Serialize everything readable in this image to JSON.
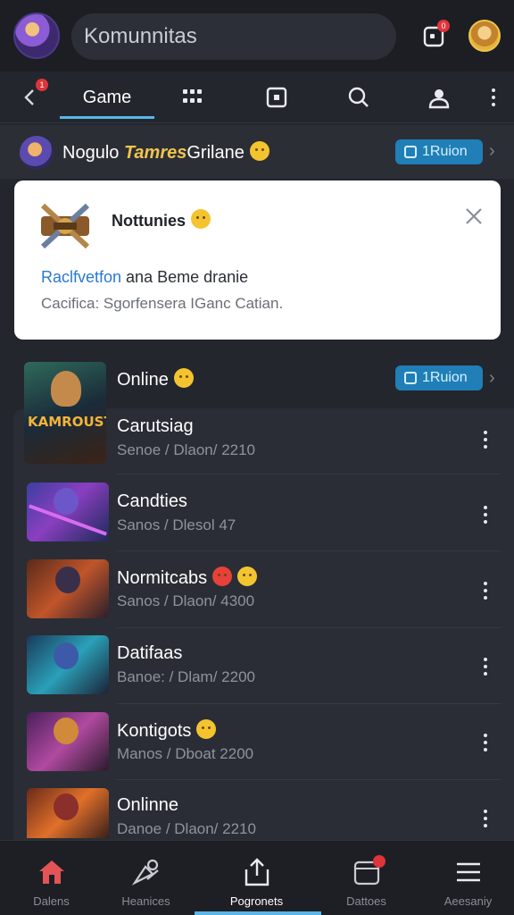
{
  "header": {
    "search_text": "Komunnitas",
    "notification_count": "0"
  },
  "tabs": {
    "active_label": "Game",
    "back_badge": "1",
    "icons": [
      "back-icon",
      "grid-icon",
      "square-icon",
      "search-icon",
      "user-icon",
      "more-icon"
    ]
  },
  "banner": {
    "title_prefix": "Nogulo ",
    "title_highlight": "Tamres",
    "title_suffix": "Grilane",
    "pill_label": "1Ruion"
  },
  "notification": {
    "title": "Nottunies",
    "line1_blue": "Raclfvetfon",
    "line1_rest": " ana  Beme dranie",
    "line2": "Cacifica: Sgorfensera IGanc Catian."
  },
  "online_header": {
    "label": "Online",
    "pill_label": "1Ruion"
  },
  "list": [
    {
      "title": "Carutsiag",
      "subtitle": "Senoe / Dlaon/ 2210",
      "thumb_text": "KAMROUST"
    },
    {
      "title": "Candties",
      "subtitle": "Sanos / Dlesol 47",
      "thumb_text": ""
    },
    {
      "title": "Normitcabs",
      "subtitle": "Sanos / Dlaon/ 4300",
      "thumb_text": ""
    },
    {
      "title": "Datifaas",
      "subtitle": "Banoe: / Dlam/ 2200",
      "thumb_text": ""
    },
    {
      "title": "Kontigots",
      "subtitle": "Manos / Dboat 2200",
      "thumb_text": ""
    },
    {
      "title": "Onlinne",
      "subtitle": "Danoe / Dlaon/ 2210",
      "thumb_text": ""
    }
  ],
  "bottom_nav": [
    {
      "label": "Dalens",
      "icon": "home-icon"
    },
    {
      "label": "Heanices",
      "icon": "tools-icon"
    },
    {
      "label": "Pogronets",
      "icon": "share-icon"
    },
    {
      "label": "Dattoes",
      "icon": "calendar-icon"
    },
    {
      "label": "Aeesaniy",
      "icon": "menu-icon"
    }
  ],
  "colors": {
    "accent": "#5ab6e8",
    "pill": "#1f7fb6",
    "badge": "#e0343b",
    "home_active": "#e45456"
  }
}
